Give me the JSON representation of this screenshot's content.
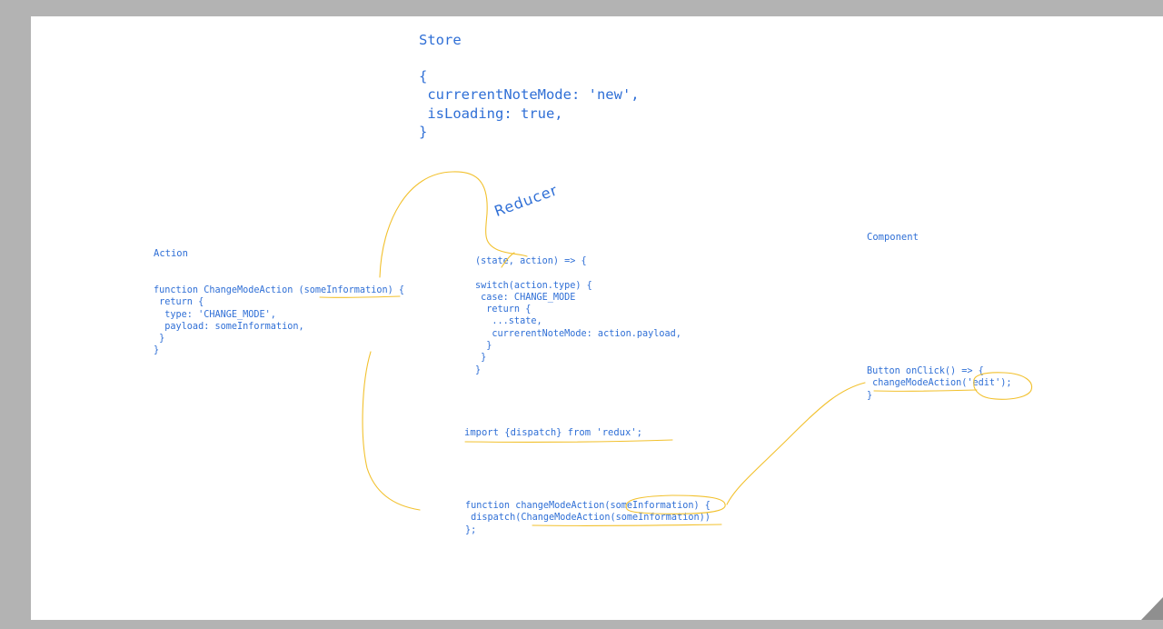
{
  "store": {
    "title": "Store",
    "code": "{\n currerentNoteMode: 'new',\n isLoading: true,\n}"
  },
  "reducer": {
    "title": "Reducer",
    "code": "(state, action) => {\n\nswitch(action.type) {\n case: CHANGE_MODE\n  return {\n   ...state,\n   currerentNoteMode: action.payload,\n  }\n }\n}"
  },
  "action": {
    "title": "Action",
    "code": "function ChangeModeAction (someInformation) {\n return {\n  type: 'CHANGE_MODE',\n  payload: someInformation,\n }\n}"
  },
  "component": {
    "title": "Component",
    "code": "Button onClick() => {\n changeModeAction('edit');\n}"
  },
  "import_line": "import {dispatch} from 'redux';",
  "dispatcher": {
    "code": "function changeModeAction(someInformation) {\n dispatch(ChangeModeAction(someInformation))\n};"
  },
  "colors": {
    "text": "#2f6fd6",
    "annotation": "#f2c12e",
    "frame": "#b3b3b3",
    "board": "#ffffff"
  }
}
